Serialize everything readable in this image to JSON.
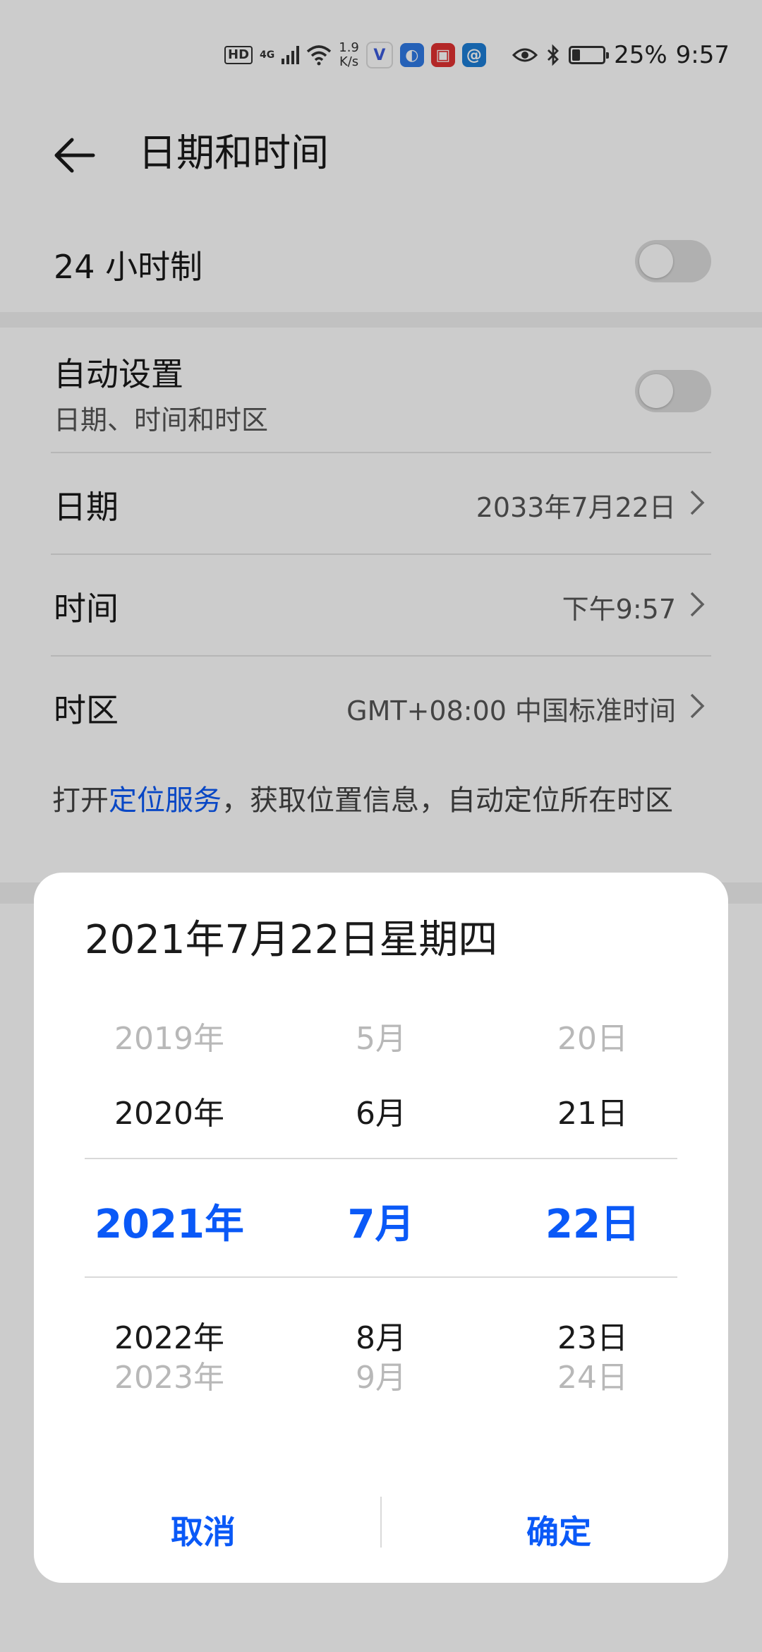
{
  "status_bar": {
    "hd": "HD",
    "network": "4G",
    "net_speed_value": "1.9",
    "net_speed_unit": "K/s",
    "battery_percent": "25%",
    "battery_level": 0.25,
    "time": "9:57",
    "app_icons": [
      "v-icon",
      "browser-icon",
      "book-icon",
      "at-icon"
    ]
  },
  "header": {
    "title": "日期和时间"
  },
  "settings": {
    "hour24_label": "24 小时制",
    "hour24_on": false,
    "auto_label": "自动设置",
    "auto_sub": "日期、时间和时区",
    "auto_on": false,
    "date_label": "日期",
    "date_value": "2033年7月22日",
    "time_label": "时间",
    "time_value": "下午9:57",
    "timezone_label": "时区",
    "timezone_value": "GMT+08:00 中国标准时间",
    "hint_prefix": "打开",
    "hint_link": "定位服务",
    "hint_suffix": "，获取位置信息，自动定位所在时区"
  },
  "dialog": {
    "title": "2021年7月22日星期四",
    "years": [
      "2019年",
      "2020年",
      "2021年",
      "2022年",
      "2023年"
    ],
    "months": [
      "5月",
      "6月",
      "7月",
      "8月",
      "9月"
    ],
    "days": [
      "20日",
      "21日",
      "22日",
      "23日",
      "24日"
    ],
    "cancel": "取消",
    "confirm": "确定"
  },
  "colors": {
    "accent": "#0a59f7",
    "overlay": "rgba(0,0,0,0.2)"
  }
}
